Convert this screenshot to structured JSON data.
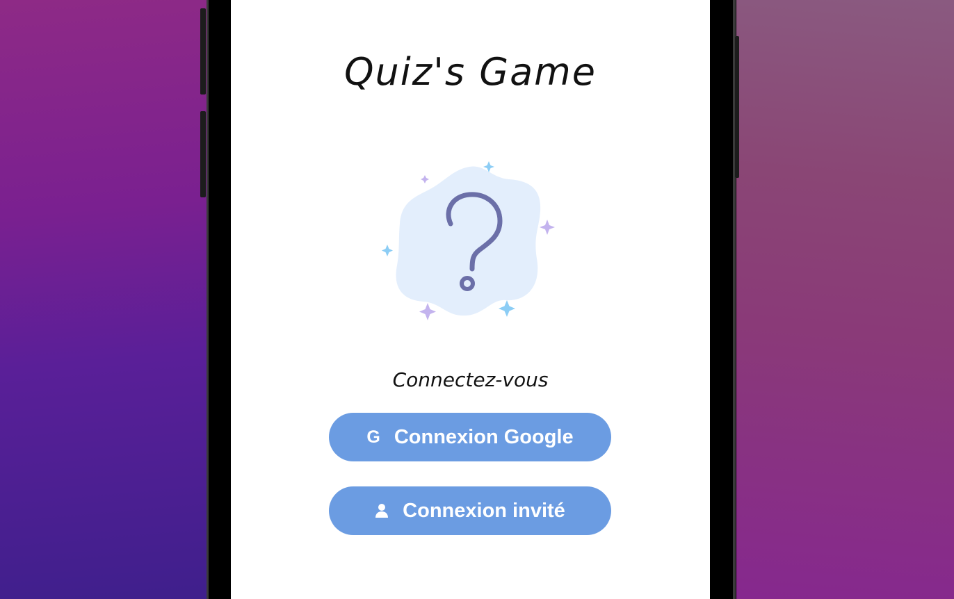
{
  "app": {
    "title": "Quiz's Game",
    "subtitle": "Connectez-vous"
  },
  "buttons": {
    "google": {
      "label": "Connexion Google",
      "icon": "google-icon",
      "icon_glyph": "G"
    },
    "guest": {
      "label": "Connexion invité",
      "icon": "user-icon"
    }
  },
  "colors": {
    "button_bg": "#6b9ce2",
    "illustration_blob": "#e3eefc",
    "question_mark": "#6b6fa8",
    "sparkle_purple": "#c3b3ee",
    "sparkle_blue": "#8ccdf5"
  }
}
